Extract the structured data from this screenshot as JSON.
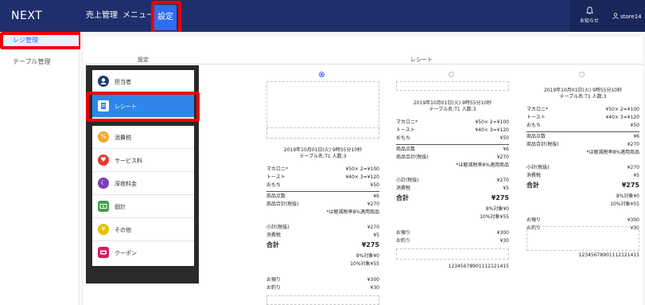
{
  "header": {
    "brand": "NEXT",
    "nav": [
      "売上管理",
      "メニュー",
      "設定"
    ],
    "notice_label": "お知らせ",
    "store_label": "store14"
  },
  "sidebar": {
    "items": [
      {
        "label": "レジ管理",
        "active": true
      },
      {
        "label": "テーブル管理",
        "active": false
      }
    ]
  },
  "columns": {
    "settings": "設定",
    "receipt": "レシート"
  },
  "settings_menu": {
    "group1": [
      {
        "label": "担当者",
        "icon": "person-icon",
        "active": false
      },
      {
        "label": "レシート",
        "icon": "receipt-icon",
        "active": true
      }
    ],
    "group2": [
      {
        "label": "消費税",
        "icon": "percent-icon"
      },
      {
        "label": "サービス料",
        "icon": "heart-icon"
      },
      {
        "label": "深夜料金",
        "icon": "moon-icon"
      },
      {
        "label": "個計",
        "icon": "bill-icon"
      },
      {
        "label": "その他",
        "icon": "yen-icon"
      },
      {
        "label": "クーポン",
        "icon": "coupon-icon"
      }
    ]
  },
  "receipt": {
    "datetime": "2019年10月01日(火) 9時55分10秒",
    "table_info": "テーブル名:T1 人数:3",
    "items": [
      {
        "name": "マカロニ*",
        "detail": "¥50× 2=¥100"
      },
      {
        "name": "トースト",
        "detail": "¥40× 3=¥120"
      },
      {
        "name": "おもち",
        "detail": "¥50"
      }
    ],
    "item_count_label": "商品点数",
    "item_count": "¥6",
    "subtotal_taxfree_label": "商品合計(税抜)",
    "subtotal_taxfree": "¥270",
    "reduced_note": "*は軽減税率8%適用商品",
    "small_total_label": "小計(税抜)",
    "small_total": "¥270",
    "tax_label": "消費税",
    "tax": "¥5",
    "total_label": "合計",
    "total": "¥275",
    "tax8": "8%対象¥0",
    "tax10": "10%対象¥55",
    "deposit_label": "お預り",
    "deposit": "¥300",
    "change_label": "お釣り",
    "change": "¥30",
    "footer_number": "12345678901112121415"
  }
}
